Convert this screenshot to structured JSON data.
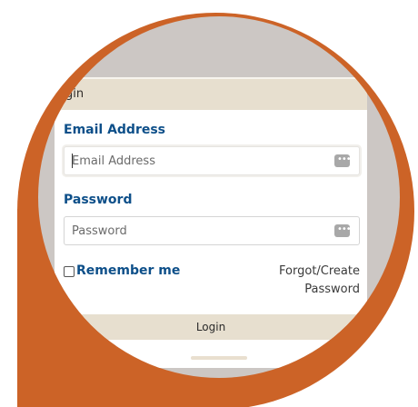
{
  "colors": {
    "accent_orange": "#cc6327",
    "label_blue": "#0d4f89",
    "header_beige": "#e7dfcf",
    "backdrop_gray": "#ccc7c4"
  },
  "login_card": {
    "header_title": "gin",
    "email": {
      "label": "Email Address",
      "placeholder": "Email Address",
      "value": "",
      "icon": "password-manager-icon"
    },
    "password": {
      "label": "Password",
      "placeholder": "Password",
      "value": "",
      "icon": "password-manager-icon"
    },
    "remember": {
      "label": "Remember me",
      "checked": false
    },
    "forgot_link": "Forgot/Create Password",
    "submit_label": "Login"
  }
}
